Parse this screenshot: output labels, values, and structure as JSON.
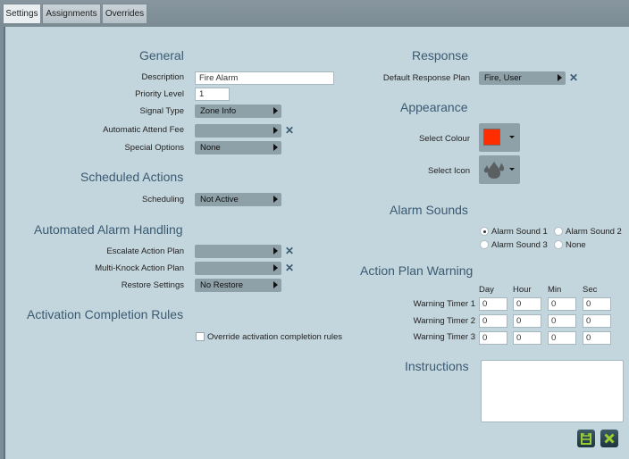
{
  "tabs": [
    {
      "label": "Settings",
      "active": true
    },
    {
      "label": "Assignments",
      "active": false
    },
    {
      "label": "Overrides",
      "active": false
    }
  ],
  "general": {
    "heading": "General",
    "description": {
      "label": "Description",
      "value": "Fire Alarm"
    },
    "priority_level": {
      "label": "Priority Level",
      "value": "1"
    },
    "signal_type": {
      "label": "Signal Type",
      "value": "Zone Info"
    },
    "automatic_attend_fee": {
      "label": "Automatic Attend Fee",
      "value": ""
    },
    "special_options": {
      "label": "Special Options",
      "value": "None"
    }
  },
  "scheduled_actions": {
    "heading": "Scheduled Actions",
    "scheduling": {
      "label": "Scheduling",
      "value": "Not Active"
    }
  },
  "automated_alarm_handling": {
    "heading": "Automated Alarm Handling",
    "escalate_action_plan": {
      "label": "Escalate Action Plan",
      "value": ""
    },
    "multi_knock_action_plan": {
      "label": "Multi-Knock Action Plan",
      "value": ""
    },
    "restore_settings": {
      "label": "Restore Settings",
      "value": "No Restore"
    }
  },
  "activation_completion_rules": {
    "heading": "Activation Completion Rules",
    "override_checkbox": {
      "label": "Override activation completion rules",
      "checked": false
    }
  },
  "response": {
    "heading": "Response",
    "default_response_plan": {
      "label": "Default Response Plan",
      "value": "Fire, User"
    }
  },
  "appearance": {
    "heading": "Appearance",
    "select_colour": {
      "label": "Select Colour",
      "color": "#ff2d00"
    },
    "select_icon": {
      "label": "Select Icon",
      "icon": "fire-icon"
    }
  },
  "alarm_sounds": {
    "heading": "Alarm Sounds",
    "options": [
      {
        "label": "Alarm Sound 1",
        "checked": true
      },
      {
        "label": "Alarm Sound 2",
        "checked": false
      },
      {
        "label": "Alarm Sound 3",
        "checked": false
      },
      {
        "label": "None",
        "checked": false
      }
    ]
  },
  "action_plan_warning": {
    "heading": "Action Plan Warning",
    "columns": [
      "Day",
      "Hour",
      "Min",
      "Sec"
    ],
    "timers": [
      {
        "label": "Warning Timer 1",
        "values": [
          "0",
          "0",
          "0",
          "0"
        ]
      },
      {
        "label": "Warning Timer 2",
        "values": [
          "0",
          "0",
          "0",
          "0"
        ]
      },
      {
        "label": "Warning Timer 3",
        "values": [
          "0",
          "0",
          "0",
          "0"
        ]
      }
    ]
  },
  "instructions": {
    "heading": "Instructions",
    "value": ""
  },
  "actions": {
    "save_icon": "save-icon",
    "cancel_icon": "close-icon",
    "accent": "#9acd32"
  }
}
